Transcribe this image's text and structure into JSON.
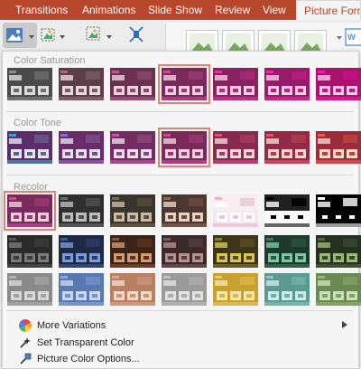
{
  "ribbon": {
    "tabs": [
      {
        "label": "Transitions",
        "name": "tab-transitions"
      },
      {
        "label": "Animations",
        "name": "tab-animations"
      },
      {
        "label": "Slide Show",
        "name": "tab-slide-show"
      },
      {
        "label": "Review",
        "name": "tab-review"
      },
      {
        "label": "View",
        "name": "tab-view"
      },
      {
        "label": "Picture Format",
        "name": "tab-picture-format"
      }
    ],
    "active_tab": "Picture Format",
    "accent_color": "#b7472a"
  },
  "gallery": {
    "sections": [
      {
        "label": "Color Saturation",
        "selected_index": 3
      },
      {
        "label": "Color Tone",
        "selected_index": 3
      },
      {
        "label": "Recolor",
        "selected_index": 0
      }
    ]
  },
  "menu": {
    "items": [
      {
        "label": "More Variations",
        "icon": "color-wheel-icon",
        "has_submenu": true
      },
      {
        "label": "Set Transparent Color",
        "icon": "eyedropper-wand-icon",
        "has_submenu": false
      },
      {
        "label": "Picture Color Options...",
        "icon": "color-options-icon",
        "has_submenu": false
      }
    ]
  }
}
